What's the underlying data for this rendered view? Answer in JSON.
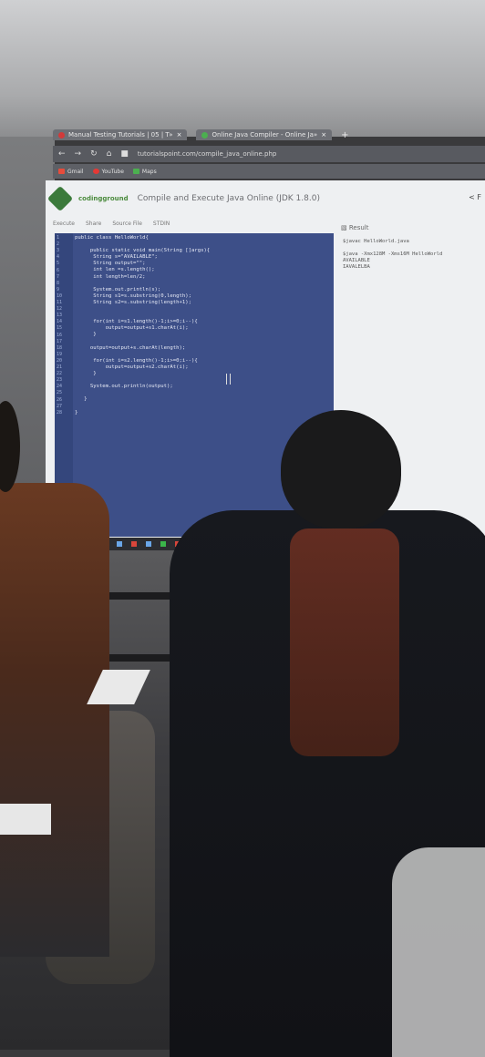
{
  "browser": {
    "tabs": [
      {
        "label": "Manual Testing Tutorials | 05 | T»",
        "close": "×"
      },
      {
        "label": "Online Java Compiler - Online Ja»",
        "close": "×"
      }
    ],
    "new_tab": "+",
    "url": "tutorialspoint.com/compile_java_online.php",
    "bookmarks": [
      "Gmail",
      "YouTube",
      "Maps"
    ]
  },
  "site": {
    "brand": "codingground",
    "title": "Compile and Execute Java Online (JDK 1.8.0)",
    "toolbar": [
      "Execute",
      "Share",
      "Source File",
      "STDIN"
    ],
    "result_label": "Result",
    "share": "< F"
  },
  "code_lines": [
    "public class HelloWorld{",
    "",
    "     public static void main(String []args){",
    "      String s=\"AVAILABLE\";",
    "      String output=\"\";",
    "      int len =s.length();",
    "      int length=len/2;",
    "",
    "      System.out.println(s);",
    "      String s1=s.substring(0,length);",
    "      String s2=s.substring(length+1);",
    "",
    "",
    "      for(int i=s1.length()-1;i>=0;i--){",
    "          output=output+s1.charAt(i);",
    "      }",
    "",
    "     output=output+s.charAt(length);",
    "",
    "      for(int i=s2.length()-1;i>=0;i--){",
    "          output=output+s2.charAt(i);",
    "      }",
    "",
    "     System.out.println(output);",
    "",
    "   }",
    "",
    "}"
  ],
  "result_lines": [
    "$javac HelloWorld.java",
    "",
    "$java -Xmx128M -Xms16M HelloWorld",
    "AVAILABLE",
    "IAVALELBA"
  ]
}
